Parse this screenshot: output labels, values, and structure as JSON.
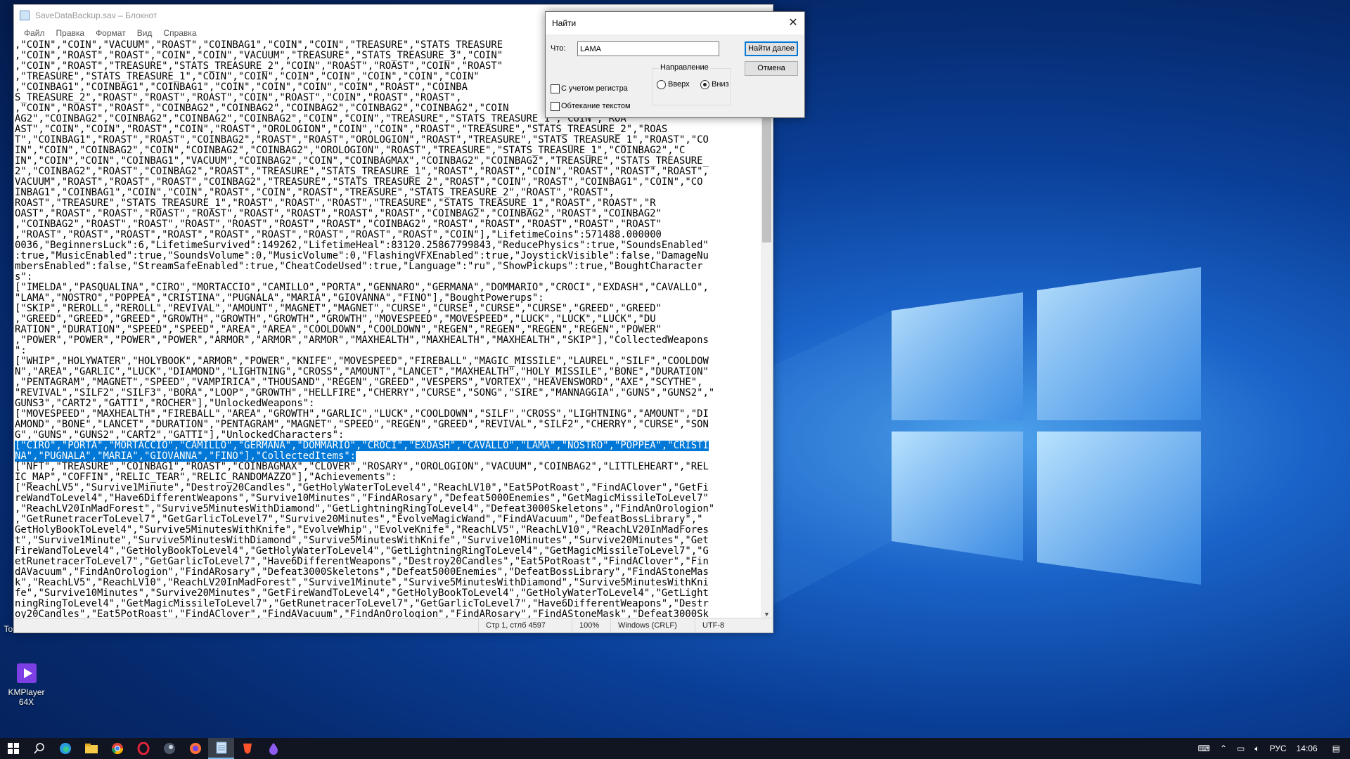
{
  "desktop": {
    "icons": [
      {
        "label": "Tor Browser",
        "icon": "tor-browser-icon"
      },
      {
        "label": "KMPlayer 64X",
        "icon": "kmplayer-icon"
      }
    ]
  },
  "notepad": {
    "title": "SaveDataBackup.sav – Блокнот",
    "menu": [
      "Файл",
      "Правка",
      "Формат",
      "Вид",
      "Справка"
    ],
    "lines": [
      ",\"COIN\",\"COIN\",\"VACUUM\",\"ROAST\",\"COINBAG1\",\"COIN\",\"COIN\",\"TREASURE\",\"STATS_TREASURE",
      ",\"COIN\",\"ROAST\",\"ROAST\",\"COIN\",\"COIN\",\"VACUUM\",\"TREASURE\",\"STATS_TREASURE_3\",\"COIN\"",
      ",\"COIN\",\"ROAST\",\"TREASURE\",\"STATS_TREASURE_2\",\"COIN\",\"ROAST\",\"ROAST\",\"COIN\",\"ROAST\"",
      ",\"TREASURE\",\"STATS_TREASURE_1\",\"COIN\",\"COIN\",\"COIN\",\"COIN\",\"COIN\",\"COIN\",\"COIN\"",
      ",\"COINBAG1\",\"COINBAG1\",\"COINBAG1\",\"COIN\",\"COIN\",\"COIN\",\"COIN\",\"ROAST\",\"COINBA",
      "S_TREASURE_2\",\"ROAST\",\"ROAST\",\"ROAST\",\"COIN\",\"ROAST\",\"COIN\",\"ROAST\",\"ROAST\",",
      ",\"COIN\",\"ROAST\",\"ROAST\",\"COINBAG2\",\"COINBAG2\",\"COINBAG2\",\"COINBAG2\",\"COINBAG2\",\"COIN",
      "AG2\",\"COINBAG2\",\"COINBAG2\",\"COINBAG2\",\"COINBAG2\",\"COIN\",\"COIN\",\"TREASURE\",\"STATS_TREASURE_1\",\"COIN\",\"ROA",
      "AST\",\"COIN\",\"COIN\",\"ROAST\",\"COIN\",\"ROAST\",\"OROLOGION\",\"COIN\",\"COIN\",\"ROAST\",\"TREASURE\",\"STATS_TREASURE_2\",\"ROAS",
      "T\",\"COINBAG1\",\"ROAST\",\"ROAST\",\"COINBAG2\",\"ROAST\",\"ROAST\",\"OROLOGION\",\"ROAST\",\"TREASURE\",\"STATS_TREASURE_1\",\"ROAST\",\"CO",
      "IN\",\"COIN\",\"COINBAG2\",\"COIN\",\"COINBAG2\",\"COINBAG2\",\"OROLOGION\",\"ROAST\",\"TREASURE\",\"STATS_TREASURE_1\",\"COINBAG2\",\"C",
      "IN\",\"COIN\",\"COIN\",\"COINBAG1\",\"VACUUM\",\"COINBAG2\",\"COIN\",\"COINBAGMAX\",\"COINBAG2\",\"COINBAG2\",\"TREASURE\",\"STATS_TREASURE_",
      "2\",\"COINBAG2\",\"ROAST\",\"COINBAG2\",\"ROAST\",\"TREASURE\",\"STATS_TREASURE_1\",\"ROAST\",\"ROAST\",\"COIN\",\"ROAST\",\"ROAST\",\"ROAST\",",
      "VACUUM\",\"ROAST\",\"ROAST\",\"ROAST\",\"COINBAG2\",\"TREASURE\",\"STATS_TREASURE_2\",\"ROAST\",\"COIN\",\"ROAST\",\"COINBAG1\",\"COIN\",\"CO",
      "INBAG1\",\"COINBAG1\",\"COIN\",\"COIN\",\"ROAST\",\"COIN\",\"ROAST\",\"TREASURE\",\"STATS_TREASURE_2\",\"ROAST\",\"ROAST\",",
      "ROAST\",\"TREASURE\",\"STATS_TREASURE_1\",\"ROAST\",\"ROAST\",\"ROAST\",\"TREASURE\",\"STATS_TREASURE_1\",\"ROAST\",\"ROAST\",\"R",
      "OAST\",\"ROAST\",\"ROAST\",\"ROAST\",\"ROAST\",\"ROAST\",\"ROAST\",\"ROAST\",\"ROAST\",\"COINBAG2\",\"COINBAG2\",\"ROAST\",\"COINBAG2\"",
      ",\"COINBAG2\",\"ROAST\",\"ROAST\",\"ROAST\",\"ROAST\",\"ROAST\",\"ROAST\",\"COINBAG2\",\"ROAST\",\"ROAST\",\"ROAST\",\"ROAST\",\"ROAST\"",
      ",\"ROAST\",\"ROAST\",\"ROAST\",\"ROAST\",\"ROAST\",\"ROAST\",\"ROAST\",\"ROAST\",\"ROAST\",\"COIN\"],\"LifetimeCoins\":571488.000000",
      "0036,\"BeginnersLuck\":6,\"LifetimeSurvived\":149262,\"LifetimeHeal\":83120.25867799843,\"ReducePhysics\":true,\"SoundsEnabled\"",
      ":true,\"MusicEnabled\":true,\"SoundsVolume\":0,\"MusicVolume\":0,\"FlashingVFXEnabled\":true,\"JoystickVisible\":false,\"DamageNu",
      "mbersEnabled\":false,\"StreamSafeEnabled\":true,\"CheatCodeUsed\":true,\"Language\":\"ru\",\"ShowPickups\":true,\"BoughtCharacter",
      "s\":",
      "[\"IMELDA\",\"PASQUALINA\",\"CIRO\",\"MORTACCIO\",\"CAMILLO\",\"PORTA\",\"GENNARO\",\"GERMANA\",\"DOMMARIO\",\"CROCI\",\"EXDASH\",\"CAVALLO\",",
      "\"LAMA\",\"NOSTRO\",\"POPPEA\",\"CRISTINA\",\"PUGNALA\",\"MARIA\",\"GIOVANNA\",\"FINO\"],\"BoughtPowerups\":",
      "[\"SKIP\",\"REROLL\",\"REROLL\",\"REVIVAL\",\"AMOUNT\",\"MAGNET\",\"MAGNET\",\"CURSE\",\"CURSE\",\"CURSE\",\"CURSE\",\"GREED\",\"GREED\"",
      ",\"GREED\",\"GREED\",\"GREED\",\"GROWTH\",\"GROWTH\",\"GROWTH\",\"GROWTH\",\"MOVESPEED\",\"MOVESPEED\",\"LUCK\",\"LUCK\",\"LUCK\",\"DU",
      "RATION\",\"DURATION\",\"SPEED\",\"SPEED\",\"AREA\",\"AREA\",\"COOLDOWN\",\"COOLDOWN\",\"REGEN\",\"REGEN\",\"REGEN\",\"REGEN\",\"POWER\"",
      ",\"POWER\",\"POWER\",\"POWER\",\"POWER\",\"ARMOR\",\"ARMOR\",\"ARMOR\",\"MAXHEALTH\",\"MAXHEALTH\",\"MAXHEALTH\",\"SKIP\"],\"CollectedWeapons",
      "\":",
      "[\"WHIP\",\"HOLYWATER\",\"HOLYBOOK\",\"ARMOR\",\"POWER\",\"KNIFE\",\"MOVESPEED\",\"FIREBALL\",\"MAGIC_MISSILE\",\"LAUREL\",\"SILF\",\"COOLDOW",
      "N\",\"AREA\",\"GARLIC\",\"LUCK\",\"DIAMOND\",\"LIGHTNING\",\"CROSS\",\"AMOUNT\",\"LANCET\",\"MAXHEALTH\",\"HOLY_MISSILE\",\"BONE\",\"DURATION\"",
      ",\"PENTAGRAM\",\"MAGNET\",\"SPEED\",\"VAMPIRICA\",\"THOUSAND\",\"REGEN\",\"GREED\",\"VESPERS\",\"VORTEX\",\"HEAVENSWORD\",\"AXE\",\"SCYTHE\",",
      "\"REVIVAL\",\"SILF2\",\"SILF3\",\"BORA\",\"LOOP\",\"GROWTH\",\"HELLFIRE\",\"CHERRY\",\"CURSE\",\"SONG\",\"SIRE\",\"MANNAGGIA\",\"GUNS\",\"GUNS2\",\"",
      "GUNS3\",\"CART2\",\"GATTI\",\"ROCHER\"],\"UnlockedWeapons\":",
      "[\"MOVESPEED\",\"MAXHEALTH\",\"FIREBALL\",\"AREA\",\"GROWTH\",\"GARLIC\",\"LUCK\",\"COOLDOWN\",\"SILF\",\"CROSS\",\"LIGHTNING\",\"AMOUNT\",\"DI",
      "AMOND\",\"BONE\",\"LANCET\",\"DURATION\",\"PENTAGRAM\",\"MAGNET\",\"SPEED\",\"REGEN\",\"GREED\",\"REVIVAL\",\"SILF2\",\"CHERRY\",\"CURSE\",\"SON",
      "G\",\"GUNS\",\"GUNS2\",\"CART2\",\"GATTI\"],\"UnlockedCharacters\":",
      "[\"CIRO\",\"PORTA\",\"MORTACCIO\",\"CAMILLO\",\"GERMANA\",\"DOMMARIO\",\"CROCI\",\"EXDASH\",\"CAVALLO\",\"LAMA\",\"NOSTRO\",\"POPPEA\",\"CRISTI",
      "NA\",\"PUGNALA\",\"MARIA\",\"GIOVANNA\",\"FINO\"],\"CollectedItems\":",
      "[\"NFT\",\"TREASURE\",\"COINBAG1\",\"ROAST\",\"COINBAGMAX\",\"CLOVER\",\"ROSARY\",\"OROLOGION\",\"VACUUM\",\"COINBAG2\",\"LITTLEHEART\",\"REL",
      "IC_MAP\",\"COFFIN\",\"RELIC_TEAR\",\"RELIC_RANDOMAZZO\"],\"Achievements\":",
      "[\"ReachLV5\",\"Survive1Minute\",\"Destroy20Candles\",\"GetHolyWaterToLevel4\",\"ReachLV10\",\"Eat5PotRoast\",\"FindAClover\",\"GetFi",
      "reWandToLevel4\",\"Have6DifferentWeapons\",\"Survive10Minutes\",\"FindARosary\",\"Defeat5000Enemies\",\"GetMagicMissileToLevel7\"",
      ",\"ReachLV20InMadForest\",\"Survive5MinutesWithDiamond\",\"GetLightningRingToLevel4\",\"Defeat3000Skeletons\",\"FindAnOrologion\"",
      ",\"GetRunetracerToLevel7\",\"GetGarlicToLevel7\",\"Survive20Minutes\",\"EvolveMagicWand\",\"FindAVacuum\",\"DefeatBossLibrary\",\"",
      "GetHolyBookToLevel4\",\"Survive5MinutesWithKnife\",\"EvolveWhip\",\"EvolveKnife\",\"ReachLV5\",\"ReachLV10\",\"ReachLV20InMadFores",
      "t\",\"Survive1Minute\",\"Survive5MinutesWithDiamond\",\"Survive5MinutesWithKnife\",\"Survive10Minutes\",\"Survive20Minutes\",\"Get",
      "FireWandToLevel4\",\"GetHolyBookToLevel4\",\"GetHolyWaterToLevel4\",\"GetLightningRingToLevel4\",\"GetMagicMissileToLevel7\",\"G",
      "etRunetracerToLevel7\",\"GetGarlicToLevel7\",\"Have6DifferentWeapons\",\"Destroy20Candles\",\"Eat5PotRoast\",\"FindAClover\",\"Fin",
      "dAVacuum\",\"FindAnOrologion\",\"FindARosary\",\"Defeat3000Skeletons\",\"Defeat5000Enemies\",\"DefeatBossLibrary\",\"FindAStoneMas",
      "k\",\"ReachLV5\",\"ReachLV10\",\"ReachLV20InMadForest\",\"Survive1Minute\",\"Survive5MinutesWithDiamond\",\"Survive5MinutesWithKni",
      "fe\",\"Survive10Minutes\",\"Survive20Minutes\",\"GetFireWandToLevel4\",\"GetHolyBookToLevel4\",\"GetHolyWaterToLevel4\",\"GetLight",
      "ningRingToLevel4\",\"GetMagicMissileToLevel7\",\"GetRunetracerToLevel7\",\"GetGarlicToLevel7\",\"Have6DifferentWeapons\",\"Destr",
      "oy20Candles\",\"Eat5PotRoast\",\"FindAClover\",\"FindAVacuum\",\"FindAnOrologion\",\"FindARosary\",\"FindAStoneMask\",\"Defeat3000Sk"
    ],
    "selected_lines": [
      38,
      39
    ],
    "status": {
      "position": "Стр 1, стлб 4597",
      "zoom": "100%",
      "line_ending": "Windows (CRLF)",
      "encoding": "UTF-8"
    }
  },
  "find_dialog": {
    "title": "Найти",
    "what_label": "Что:",
    "query": "LAMA",
    "find_next": "Найти далее",
    "cancel": "Отмена",
    "direction_label": "Направление",
    "up": "Вверх",
    "down": "Вниз",
    "direction_selected": "down",
    "match_case": "С учетом регистра",
    "wrap": "Обтекание текстом",
    "match_case_checked": false,
    "wrap_checked": false
  },
  "taskbar": {
    "apps": [
      "start-icon",
      "search-icon",
      "edge-icon",
      "file-explorer-icon",
      "chrome-icon",
      "opera-icon",
      "steam-icon",
      "firefox-icon",
      "notepad-icon",
      "brave-icon",
      "app-icon"
    ],
    "active_app": "notepad-icon",
    "lang": "РУС",
    "time": "14:06"
  }
}
